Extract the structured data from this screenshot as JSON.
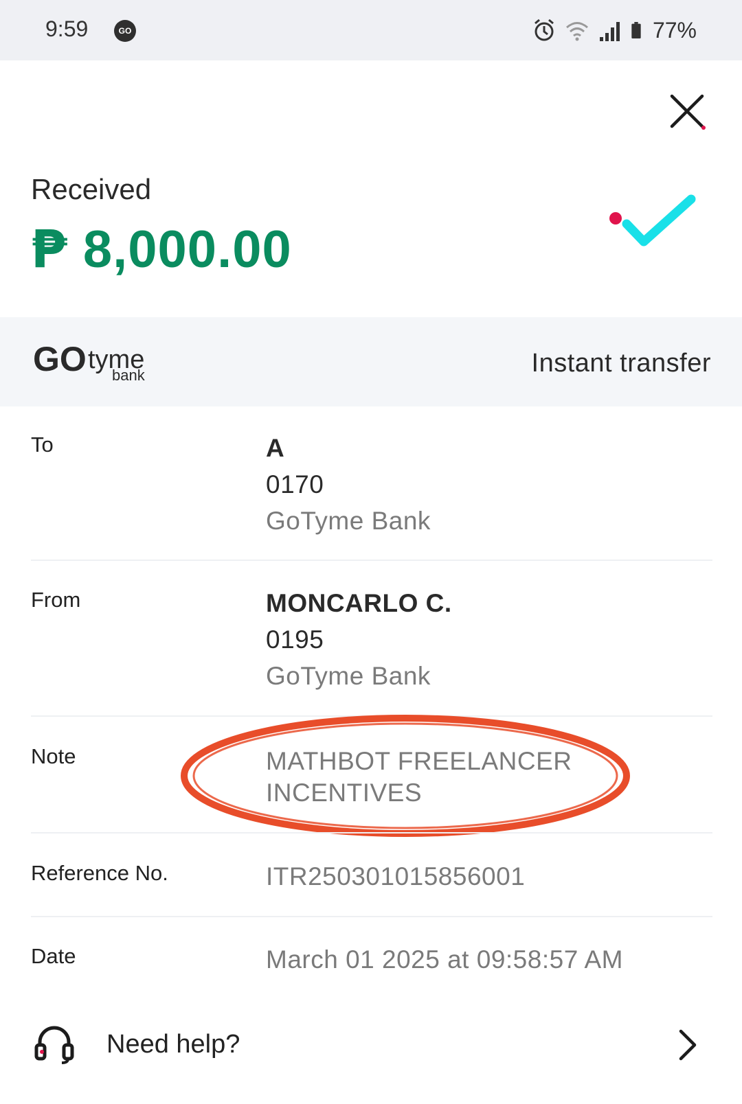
{
  "status_bar": {
    "time": "9:59",
    "app_icon_text": "GO",
    "battery": "77%"
  },
  "header": {
    "status_label": "Received",
    "currency_symbol": "₱",
    "amount": "8,000.00",
    "amount_color": "#0a8c5f",
    "check_color": "#19e0e8",
    "dot_color": "#e0144c"
  },
  "bank": {
    "logo_text_main": "GO",
    "logo_text_tyme": "tyme",
    "logo_text_bank": "bank",
    "transfer_type": "Instant transfer"
  },
  "details": {
    "to": {
      "label": "To",
      "name": "A",
      "account": "0170",
      "bank": "GoTyme Bank"
    },
    "from": {
      "label": "From",
      "name": "MONCARLO C.",
      "account": "0195",
      "bank": "GoTyme Bank"
    },
    "note": {
      "label": "Note",
      "line1": "MATHBOT FREELANCER",
      "line2": "INCENTIVES"
    },
    "reference": {
      "label": "Reference No.",
      "value": "ITR250301015856001"
    },
    "date": {
      "label": "Date",
      "value": "March 01 2025 at 09:58:57 AM"
    }
  },
  "help": {
    "label": "Need help?"
  },
  "icons": {
    "close": "close-icon",
    "check": "check-icon",
    "help": "headset-icon",
    "chevron": "chevron-right-icon"
  }
}
